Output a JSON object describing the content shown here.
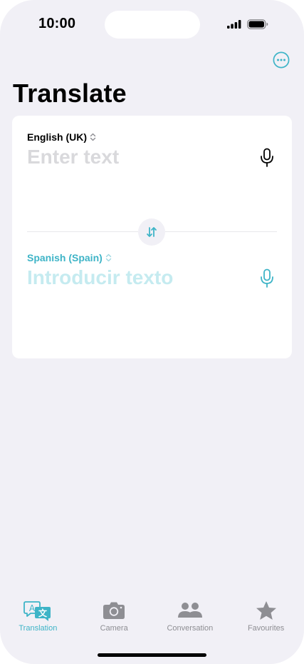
{
  "status_bar": {
    "time": "10:00"
  },
  "page": {
    "title": "Translate"
  },
  "source": {
    "language": "English (UK)",
    "placeholder": "Enter text"
  },
  "target": {
    "language": "Spanish (Spain)",
    "placeholder": "Introducir texto"
  },
  "tabs": [
    {
      "label": "Translation",
      "icon": "translation-icon",
      "active": true
    },
    {
      "label": "Camera",
      "icon": "camera-icon",
      "active": false
    },
    {
      "label": "Conversation",
      "icon": "conversation-icon",
      "active": false
    },
    {
      "label": "Favourites",
      "icon": "star-icon",
      "active": false
    }
  ],
  "colors": {
    "accent": "#3eb4c7",
    "background": "#f1f0f6",
    "card": "#ffffff",
    "inactive": "#8e8e93"
  }
}
